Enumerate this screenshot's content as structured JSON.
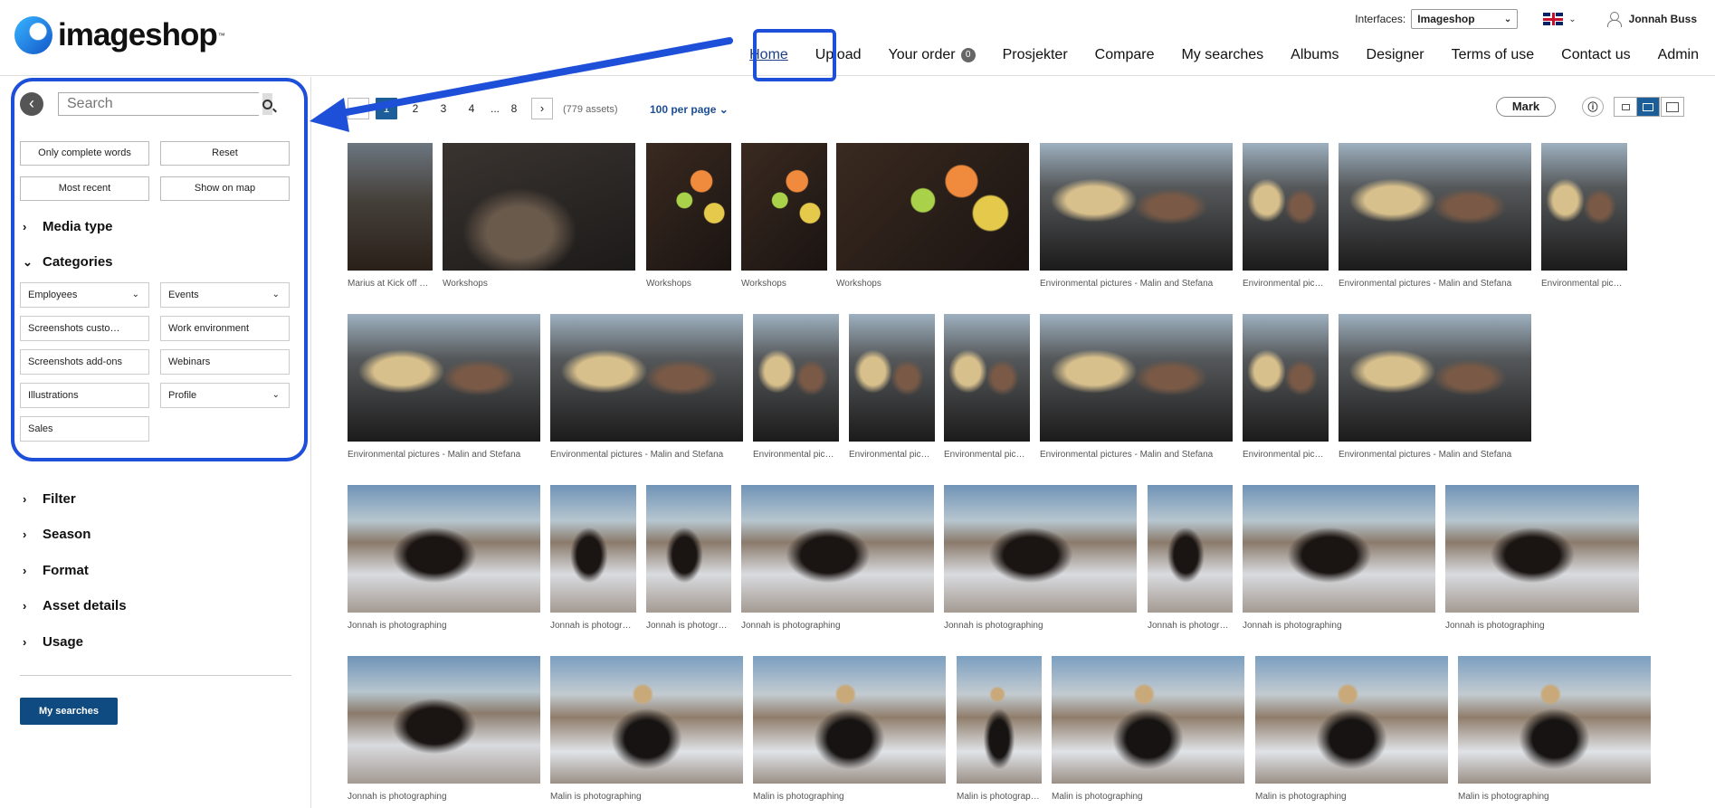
{
  "header": {
    "logo_text": "imageshop",
    "logo_tm": "™",
    "interfaces_label": "Interfaces:",
    "interface_value": "Imageshop",
    "user_name": "Jonnah Buss",
    "nav": [
      {
        "label": "Home"
      },
      {
        "label": "Upload"
      },
      {
        "label": "Your order",
        "badge": "0"
      },
      {
        "label": "Prosjekter"
      },
      {
        "label": "Compare"
      },
      {
        "label": "My searches"
      },
      {
        "label": "Albums"
      },
      {
        "label": "Designer"
      },
      {
        "label": "Terms of use"
      },
      {
        "label": "Contact us"
      },
      {
        "label": "Admin"
      }
    ]
  },
  "sidebar": {
    "search_placeholder": "Search",
    "btn_complete_words": "Only complete words",
    "btn_reset": "Reset",
    "btn_most_recent": "Most recent",
    "btn_show_on_map": "Show on map",
    "media_type": "Media type",
    "categories": "Categories",
    "category_items": [
      "Employees",
      "Events",
      "Screenshots custo…",
      "Work environment",
      "Screenshots add-ons",
      "Webinars",
      "Illustrations",
      "Profile",
      "Sales"
    ],
    "filter": "Filter",
    "season": "Season",
    "format": "Format",
    "asset_details": "Asset details",
    "usage": "Usage",
    "my_searches": "My searches"
  },
  "toolbar": {
    "prev": "‹",
    "next": "›",
    "pages": [
      "1",
      "2",
      "3",
      "4",
      "...",
      "8"
    ],
    "current_page": "1",
    "assets_count": "(779 assets)",
    "per_page": "100 per page",
    "mark": "Mark"
  },
  "captions": {
    "r1": [
      "Marius at Kick off 2…",
      "Workshops",
      "Workshops",
      "Workshops",
      "Workshops",
      "Environmental pictures - Malin and Stefana",
      "Environmental pic…",
      "Environmental pictures - Malin and Stefana",
      "Environmental pic…"
    ],
    "r2": [
      "Environmental pictures - Malin and Stefana",
      "Environmental pictures - Malin and Stefana",
      "Environmental pic…",
      "Environmental pic…",
      "Environmental pic…",
      "Environmental pictures - Malin and Stefana",
      "Environmental pic…",
      "Environmental pictures - Malin and Stefana"
    ],
    "r3": [
      "Jonnah is photographing",
      "Jonnah is photogr…",
      "Jonnah is photogr…",
      "Jonnah is photographing",
      "Jonnah is photographing",
      "Jonnah is photogr…",
      "Jonnah is photographing",
      "Jonnah is photographing"
    ],
    "r4": [
      "Jonnah is photographing",
      "Malin is photographing",
      "Malin is photographing",
      "Malin is photograp…",
      "Malin is photographing",
      "Malin is photographing",
      "Malin is photographing"
    ]
  },
  "colors": {
    "accent": "#1c5e99",
    "annotation": "#1e4fd8",
    "button": "#0f4a80"
  }
}
